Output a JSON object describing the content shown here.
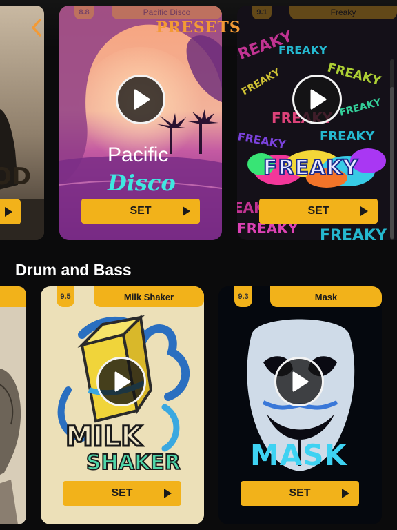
{
  "header": {
    "title": "PRESETS"
  },
  "top_row": {
    "cards": [
      {
        "id": "prev",
        "set_label": "",
        "art_text": "OD"
      },
      {
        "id": "pacific",
        "score": "8.8",
        "name": "Pacific Disco",
        "line1": "Pacific",
        "line2": "Disco",
        "set_label": "SET"
      },
      {
        "id": "freaky",
        "score": "9.1",
        "name": "Freaky",
        "line1": "FREAKY",
        "set_label": "SET"
      }
    ]
  },
  "section": {
    "title": "Drum and Bass"
  },
  "bottom_row": {
    "cards": [
      {
        "id": "prev"
      },
      {
        "id": "milk",
        "score": "9.5",
        "name": "Milk Shaker",
        "line1": "MILK",
        "line2": "SHAKER",
        "set_label": "SET"
      },
      {
        "id": "mask",
        "score": "9.3",
        "name": "Mask",
        "line1": "MASK",
        "set_label": "SET"
      }
    ]
  },
  "colors": {
    "accent": "#f2b21a",
    "title": "#f39a35",
    "background": "#0b0b0c"
  },
  "icons": {
    "back": "chevron-left-icon",
    "play": "play-icon",
    "set": "triangle-right-icon"
  }
}
